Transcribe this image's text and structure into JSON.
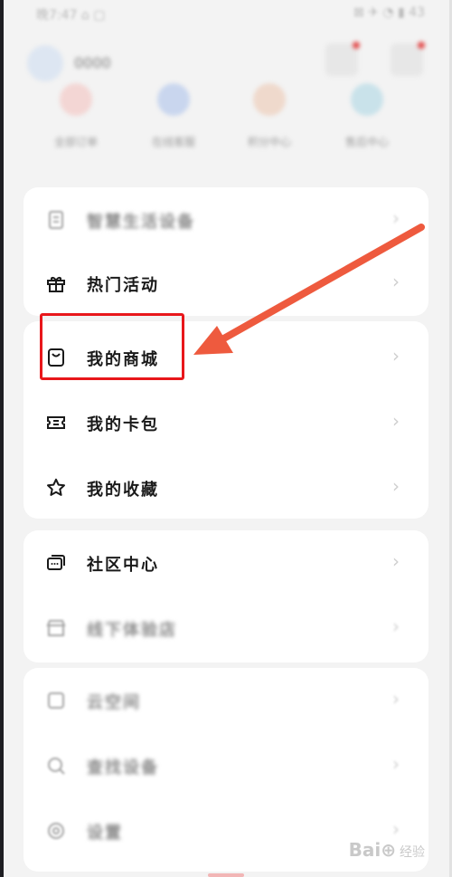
{
  "status_bar": {
    "left_text": "晚7:47 ⌂ ▢",
    "right_text": "⊠ ✈ ◔ ▮ 43"
  },
  "profile": {
    "username": "0000"
  },
  "quick_actions": [
    {
      "label": "全部订单",
      "color": "#f3d6d4"
    },
    {
      "label": "在线客服",
      "color": "#c9d6ee"
    },
    {
      "label": "积分中心",
      "color": "#efd9cc"
    },
    {
      "label": "售后中心",
      "color": "#c9e2ea"
    }
  ],
  "menu": {
    "card1": [
      {
        "label": "智慧生活设备",
        "icon": "device-list-icon"
      },
      {
        "label": "热门活动",
        "icon": "gift-icon"
      }
    ],
    "card2": [
      {
        "label": "我的商城",
        "icon": "shopping-bag-icon"
      },
      {
        "label": "我的卡包",
        "icon": "ticket-icon"
      },
      {
        "label": "我的收藏",
        "icon": "star-icon"
      }
    ],
    "card3": [
      {
        "label": "社区中心",
        "icon": "chat-icon"
      },
      {
        "label": "线下体验店",
        "icon": "store-icon"
      }
    ],
    "card4": [
      {
        "label": "云空间",
        "icon": "cloud-icon"
      },
      {
        "label": "查找设备",
        "icon": "search-device-icon"
      },
      {
        "label": "设置",
        "icon": "settings-icon"
      }
    ]
  },
  "chevron": "›",
  "annotation": {
    "highlight_color": "#e8171b",
    "arrow_color": "#ee5a3e"
  },
  "watermark": {
    "brand": "Bai⊕",
    "sub": "经验"
  }
}
